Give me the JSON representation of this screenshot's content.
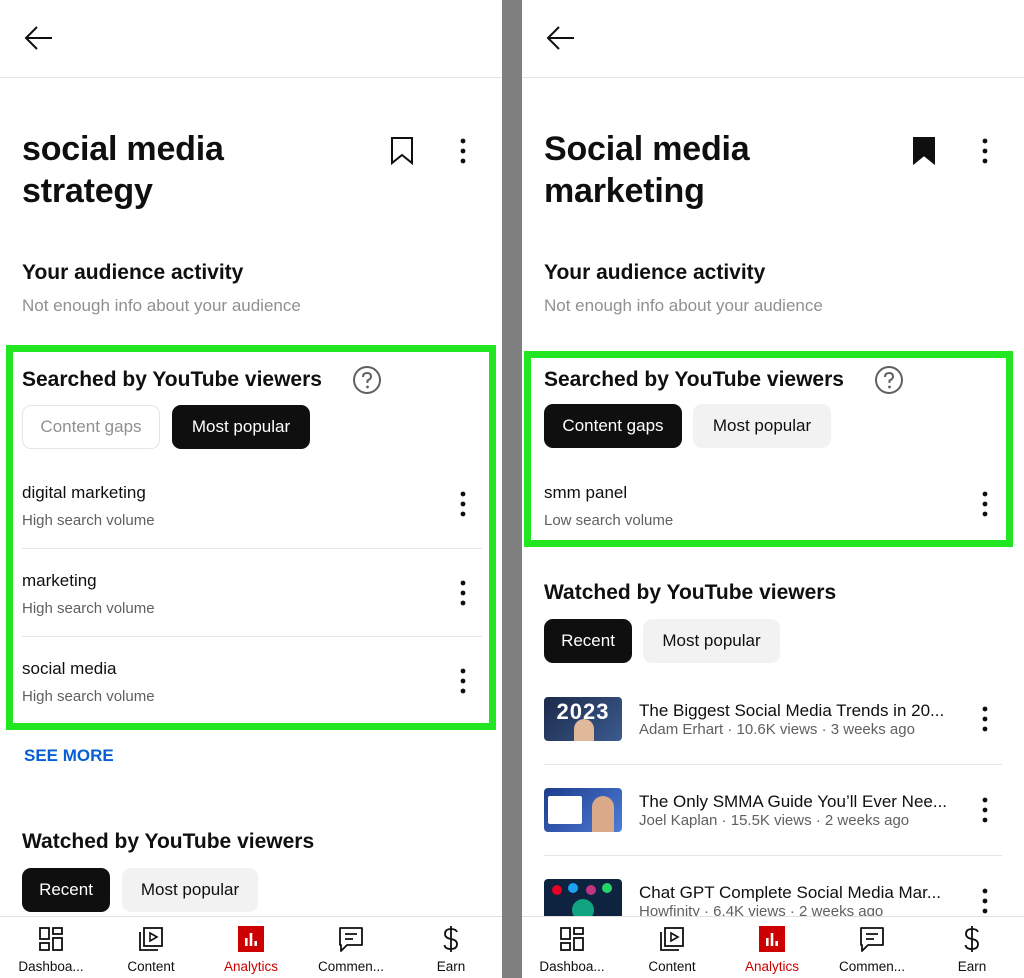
{
  "left": {
    "title_line1": "social media",
    "title_line2": "strategy",
    "audience_title": "Your audience activity",
    "audience_sub": "Not enough info about your audience",
    "searched_title": "Searched by YouTube viewers",
    "chips": [
      "Content gaps",
      "Most popular"
    ],
    "searches": [
      {
        "term": "digital marketing",
        "volume": "High search volume"
      },
      {
        "term": "marketing",
        "volume": "High search volume"
      },
      {
        "term": "social media",
        "volume": "High search volume"
      }
    ],
    "see_more": "SEE MORE",
    "watched_title": "Watched by YouTube viewers",
    "watched_chips": [
      "Recent",
      "Most popular"
    ]
  },
  "right": {
    "title_line1": "Social media",
    "title_line2": "marketing",
    "audience_title": "Your audience activity",
    "audience_sub": "Not enough info about your audience",
    "searched_title": "Searched by YouTube viewers",
    "chips": [
      "Content gaps",
      "Most popular"
    ],
    "searches": [
      {
        "term": "smm panel",
        "volume": "Low search volume"
      }
    ],
    "watched_title": "Watched by YouTube viewers",
    "watched_chips": [
      "Recent",
      "Most popular"
    ],
    "videos": [
      {
        "title": "The Biggest Social Media Trends in 20...",
        "meta": "Adam Erhart · 10.6K views · 3 weeks ago",
        "thumb_text": "2023"
      },
      {
        "title": "The Only SMMA Guide You’ll Ever Nee...",
        "meta": "Joel Kaplan · 15.5K views · 2 weeks ago"
      },
      {
        "title": "Chat GPT Complete Social Media Mar...",
        "meta": "Howfinity · 6.4K views · 2 weeks ago"
      }
    ]
  },
  "nav": [
    {
      "label": "Dashboa...",
      "icon": "dashboard-icon"
    },
    {
      "label": "Content",
      "icon": "content-icon"
    },
    {
      "label": "Analytics",
      "icon": "analytics-icon"
    },
    {
      "label": "Commen...",
      "icon": "comments-icon"
    },
    {
      "label": "Earn",
      "icon": "dollar-icon"
    }
  ],
  "colors": {
    "highlight": "#22e622",
    "active": "#cc0000",
    "link": "#065fd4"
  }
}
